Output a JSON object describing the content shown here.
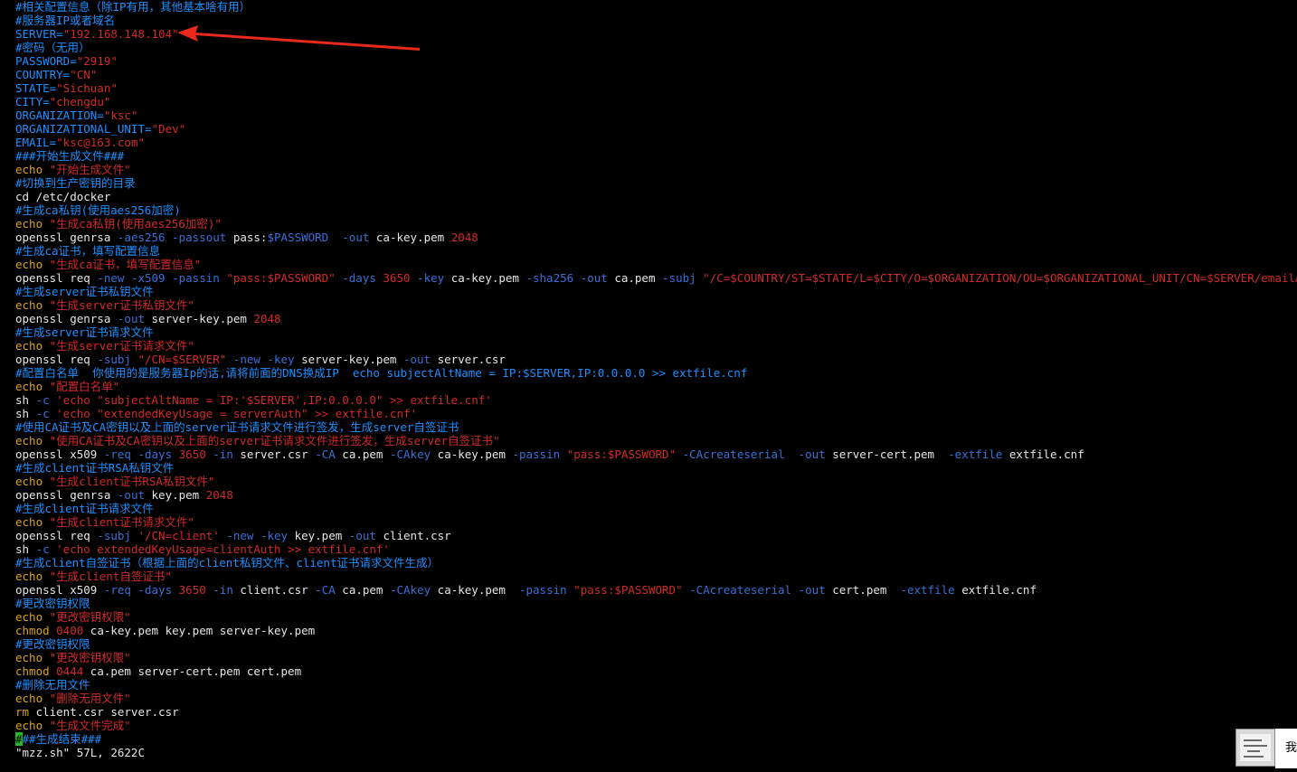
{
  "colors": {
    "comment": "#1e90ff",
    "plain": "#e6e6e6",
    "string": "#d22a2a",
    "keyword": "#d8a21e",
    "option": "#3b6fd9",
    "number": "#d22a2a",
    "arrow": "#e8291c",
    "cursor": "#1ec01e"
  },
  "lines": [
    [
      [
        "#相关配置信息（除IP有用，其他基本啥有用）",
        "comment"
      ]
    ],
    [
      [
        "#服务器IP或者域名",
        "comment"
      ]
    ],
    [
      [
        "SERVER=",
        "comment"
      ],
      [
        "\"192.168.148.104\"",
        "string"
      ]
    ],
    [
      [
        "#密码（无用）",
        "comment"
      ]
    ],
    [
      [
        "PASSWORD=",
        "comment"
      ],
      [
        "\"2919\"",
        "string"
      ]
    ],
    [
      [
        "COUNTRY=",
        "comment"
      ],
      [
        "\"CN\"",
        "string"
      ]
    ],
    [
      [
        "STATE=",
        "comment"
      ],
      [
        "\"Sichuan\"",
        "string"
      ]
    ],
    [
      [
        "CITY=",
        "comment"
      ],
      [
        "\"chengdu\"",
        "string"
      ]
    ],
    [
      [
        "ORGANIZATION=",
        "comment"
      ],
      [
        "\"ksc\"",
        "string"
      ]
    ],
    [
      [
        "ORGANIZATIONAL_UNIT=",
        "comment"
      ],
      [
        "\"Dev\"",
        "string"
      ]
    ],
    [
      [
        "EMAIL=",
        "comment"
      ],
      [
        "\"ksc@163.com\"",
        "string"
      ]
    ],
    [
      [
        "###开始生成文件###",
        "comment"
      ]
    ],
    [
      [
        "echo ",
        "keyword"
      ],
      [
        "\"开始生成文件\"",
        "string"
      ]
    ],
    [
      [
        "#切换到生产密钥的目录",
        "comment"
      ]
    ],
    [
      [
        "cd /etc/docker",
        "plain"
      ]
    ],
    [
      [
        "#生成ca私钥(使用aes256加密)",
        "comment"
      ]
    ],
    [
      [
        "echo ",
        "keyword"
      ],
      [
        "\"生成ca私钥(使用aes256加密)\"",
        "string"
      ]
    ],
    [
      [
        "openssl genrsa ",
        "plain"
      ],
      [
        "-aes256 -passout ",
        "option"
      ],
      [
        "pass:",
        "plain"
      ],
      [
        "$PASSWORD  ",
        "option"
      ],
      [
        "-out ",
        "option"
      ],
      [
        "ca-key.pem ",
        "plain"
      ],
      [
        "2048",
        "number"
      ]
    ],
    [
      [
        "#生成ca证书，填写配置信息",
        "comment"
      ]
    ],
    [
      [
        "echo ",
        "keyword"
      ],
      [
        "\"生成ca证书，填写配置信息\"",
        "string"
      ]
    ],
    [
      [
        "openssl req ",
        "plain"
      ],
      [
        "-new -x509 -passin ",
        "option"
      ],
      [
        "\"pass:$PASSWORD\" ",
        "string"
      ],
      [
        "-days ",
        "option"
      ],
      [
        "3650 ",
        "number"
      ],
      [
        "-key ",
        "option"
      ],
      [
        "ca-key.pem ",
        "plain"
      ],
      [
        "-sha256 -out ",
        "option"
      ],
      [
        "ca.pem ",
        "plain"
      ],
      [
        "-subj ",
        "option"
      ],
      [
        "\"/C=$COUNTRY/ST=$STATE/L=$CITY/O=$ORGANIZATION/OU=$ORGANIZATIONAL_UNIT/CN=$SERVER/emailAddress=$EMAIL\"",
        "string"
      ]
    ],
    [
      [
        "#生成server证书私钥文件",
        "comment"
      ]
    ],
    [
      [
        "echo ",
        "keyword"
      ],
      [
        "\"生成server证书私钥文件\"",
        "string"
      ]
    ],
    [
      [
        "openssl genrsa ",
        "plain"
      ],
      [
        "-out ",
        "option"
      ],
      [
        "server-key.pem ",
        "plain"
      ],
      [
        "2048",
        "number"
      ]
    ],
    [
      [
        "#生成server证书请求文件",
        "comment"
      ]
    ],
    [
      [
        "echo ",
        "keyword"
      ],
      [
        "\"生成server证书请求文件\"",
        "string"
      ]
    ],
    [
      [
        "openssl req ",
        "plain"
      ],
      [
        "-subj ",
        "option"
      ],
      [
        "\"/CN=$SERVER\" ",
        "string"
      ],
      [
        "-new -key ",
        "option"
      ],
      [
        "server-key.pem ",
        "plain"
      ],
      [
        "-out ",
        "option"
      ],
      [
        "server.csr",
        "plain"
      ]
    ],
    [
      [
        "#配置白名单  你使用的是服务器Ip的话,请将前面的DNS换成IP  echo subjectAltName = IP:$SERVER,IP:0.0.0.0 >> extfile.cnf",
        "comment"
      ]
    ],
    [
      [
        "echo ",
        "keyword"
      ],
      [
        "\"配置白名单\"",
        "string"
      ]
    ],
    [
      [
        "sh ",
        "plain"
      ],
      [
        "-c ",
        "option"
      ],
      [
        "'echo \"subjectAltName = IP:'$SERVER',IP:0.0.0.0\" >> extfile.cnf'",
        "string"
      ]
    ],
    [
      [
        "sh ",
        "plain"
      ],
      [
        "-c ",
        "option"
      ],
      [
        "'echo \"extendedKeyUsage = serverAuth\" >> extfile.cnf'",
        "string"
      ]
    ],
    [
      [
        "#使用CA证书及CA密钥以及上面的server证书请求文件进行签发，生成server自签证书",
        "comment"
      ]
    ],
    [
      [
        "echo ",
        "keyword"
      ],
      [
        "\"使用CA证书及CA密钥以及上面的server证书请求文件进行签发，生成server自签证书\"",
        "string"
      ]
    ],
    [
      [
        "openssl x509 ",
        "plain"
      ],
      [
        "-req -days ",
        "option"
      ],
      [
        "3650 ",
        "number"
      ],
      [
        "-in ",
        "option"
      ],
      [
        "server.csr ",
        "plain"
      ],
      [
        "-CA ",
        "option"
      ],
      [
        "ca.pem ",
        "plain"
      ],
      [
        "-CAkey ",
        "option"
      ],
      [
        "ca-key.pem ",
        "plain"
      ],
      [
        "-passin ",
        "option"
      ],
      [
        "\"pass:$PASSWORD\" ",
        "string"
      ],
      [
        "-CAcreateserial  -out ",
        "option"
      ],
      [
        "server-cert.pem  ",
        "plain"
      ],
      [
        "-extfile ",
        "option"
      ],
      [
        "extfile.cnf",
        "plain"
      ]
    ],
    [
      [
        "#生成client证书RSA私钥文件",
        "comment"
      ]
    ],
    [
      [
        "echo ",
        "keyword"
      ],
      [
        "\"生成client证书RSA私钥文件\"",
        "string"
      ]
    ],
    [
      [
        "openssl genrsa ",
        "plain"
      ],
      [
        "-out ",
        "option"
      ],
      [
        "key.pem ",
        "plain"
      ],
      [
        "2048",
        "number"
      ]
    ],
    [
      [
        "#生成client证书请求文件",
        "comment"
      ]
    ],
    [
      [
        "echo ",
        "keyword"
      ],
      [
        "\"生成client证书请求文件\"",
        "string"
      ]
    ],
    [
      [
        "openssl req ",
        "plain"
      ],
      [
        "-subj ",
        "option"
      ],
      [
        "'/CN=client' ",
        "string"
      ],
      [
        "-new -key ",
        "option"
      ],
      [
        "key.pem ",
        "plain"
      ],
      [
        "-out ",
        "option"
      ],
      [
        "client.csr",
        "plain"
      ]
    ],
    [
      [
        "sh ",
        "plain"
      ],
      [
        "-c ",
        "option"
      ],
      [
        "'echo extendedKeyUsage=clientAuth >> extfile.cnf'",
        "string"
      ]
    ],
    [
      [
        "#生成client自签证书（根据上面的client私钥文件、client证书请求文件生成）",
        "comment"
      ]
    ],
    [
      [
        "echo ",
        "keyword"
      ],
      [
        "\"生成client自签证书\"",
        "string"
      ]
    ],
    [
      [
        "openssl x509 ",
        "plain"
      ],
      [
        "-req -days ",
        "option"
      ],
      [
        "3650 ",
        "number"
      ],
      [
        "-in ",
        "option"
      ],
      [
        "client.csr ",
        "plain"
      ],
      [
        "-CA ",
        "option"
      ],
      [
        "ca.pem ",
        "plain"
      ],
      [
        "-CAkey ",
        "option"
      ],
      [
        "ca-key.pem  ",
        "plain"
      ],
      [
        "-passin ",
        "option"
      ],
      [
        "\"pass:$PASSWORD\" ",
        "string"
      ],
      [
        "-CAcreateserial -out ",
        "option"
      ],
      [
        "cert.pem  ",
        "plain"
      ],
      [
        "-extfile ",
        "option"
      ],
      [
        "extfile.cnf",
        "plain"
      ]
    ],
    [
      [
        "#更改密钥权限",
        "comment"
      ]
    ],
    [
      [
        "echo ",
        "keyword"
      ],
      [
        "\"更改密钥权限\"",
        "string"
      ]
    ],
    [
      [
        "chmod ",
        "keyword"
      ],
      [
        "0400 ",
        "number"
      ],
      [
        "ca-key.pem key.pem server-key.pem",
        "plain"
      ]
    ],
    [
      [
        "#更改密钥权限",
        "comment"
      ]
    ],
    [
      [
        "echo ",
        "keyword"
      ],
      [
        "\"更改密钥权限\"",
        "string"
      ]
    ],
    [
      [
        "chmod ",
        "keyword"
      ],
      [
        "0444 ",
        "number"
      ],
      [
        "ca.pem server-cert.pem cert.pem",
        "plain"
      ]
    ],
    [
      [
        "#删除无用文件",
        "comment"
      ]
    ],
    [
      [
        "echo ",
        "keyword"
      ],
      [
        "\"删除无用文件\"",
        "string"
      ]
    ],
    [
      [
        "rm ",
        "keyword"
      ],
      [
        "client.csr server.csr",
        "plain"
      ]
    ],
    [
      [
        "echo ",
        "keyword"
      ],
      [
        "\"生成文件完成\"",
        "string"
      ]
    ],
    [
      [
        "#",
        "cursor"
      ],
      [
        "##生成结束###",
        "comment"
      ]
    ],
    [
      [
        "\"mzz.sh\" 57L, 2622C",
        "plain"
      ]
    ]
  ],
  "side_panel": {
    "text": "我"
  },
  "icons": {
    "thumbnail": "screenshot-thumbnail-icon",
    "arrow": "red-annotation-arrow"
  }
}
